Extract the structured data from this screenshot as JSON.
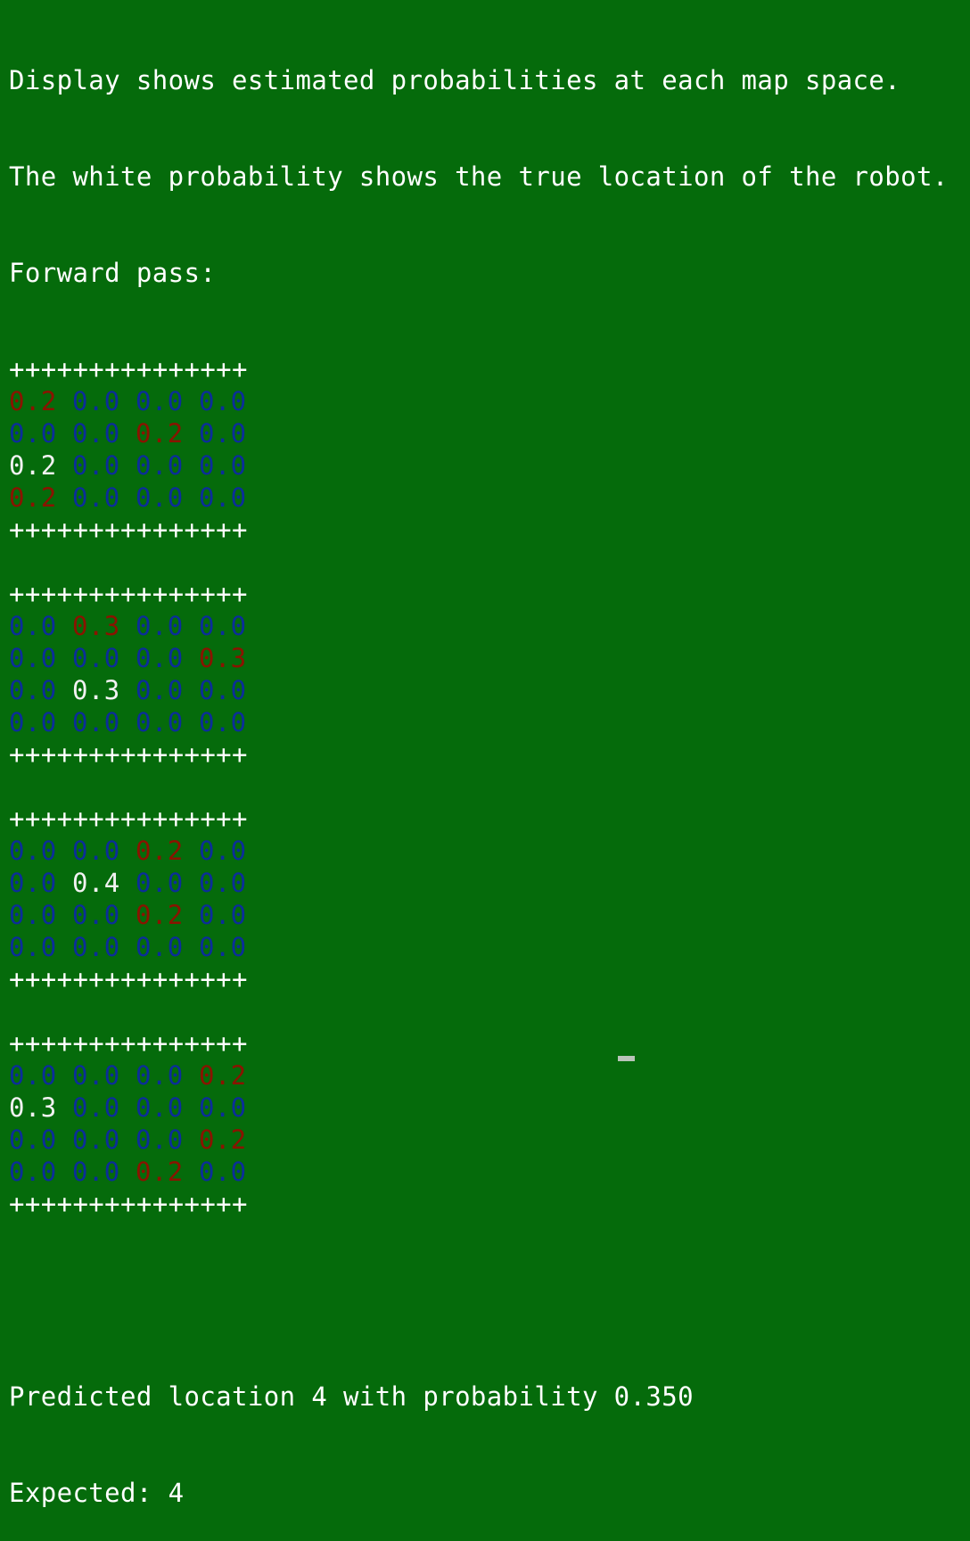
{
  "terminal": {
    "intro_lines": [
      "Display shows estimated probabilities at each map space.",
      "The white probability shows the true location of the robot.",
      "Forward pass:"
    ],
    "border": "+++++++++++++++",
    "grids": [
      {
        "rows": [
          [
            {
              "v": "0.2",
              "c": "red"
            },
            {
              "v": "0.0",
              "c": "blue"
            },
            {
              "v": "0.0",
              "c": "blue"
            },
            {
              "v": "0.0",
              "c": "blue"
            }
          ],
          [
            {
              "v": "0.0",
              "c": "blue"
            },
            {
              "v": "0.0",
              "c": "blue"
            },
            {
              "v": "0.2",
              "c": "red"
            },
            {
              "v": "0.0",
              "c": "blue"
            }
          ],
          [
            {
              "v": "0.2",
              "c": "white"
            },
            {
              "v": "0.0",
              "c": "blue"
            },
            {
              "v": "0.0",
              "c": "blue"
            },
            {
              "v": "0.0",
              "c": "blue"
            }
          ],
          [
            {
              "v": "0.2",
              "c": "red"
            },
            {
              "v": "0.0",
              "c": "blue"
            },
            {
              "v": "0.0",
              "c": "blue"
            },
            {
              "v": "0.0",
              "c": "blue"
            }
          ]
        ]
      },
      {
        "rows": [
          [
            {
              "v": "0.0",
              "c": "blue"
            },
            {
              "v": "0.3",
              "c": "red"
            },
            {
              "v": "0.0",
              "c": "blue"
            },
            {
              "v": "0.0",
              "c": "blue"
            }
          ],
          [
            {
              "v": "0.0",
              "c": "blue"
            },
            {
              "v": "0.0",
              "c": "blue"
            },
            {
              "v": "0.0",
              "c": "blue"
            },
            {
              "v": "0.3",
              "c": "red"
            }
          ],
          [
            {
              "v": "0.0",
              "c": "blue"
            },
            {
              "v": "0.3",
              "c": "white"
            },
            {
              "v": "0.0",
              "c": "blue"
            },
            {
              "v": "0.0",
              "c": "blue"
            }
          ],
          [
            {
              "v": "0.0",
              "c": "blue"
            },
            {
              "v": "0.0",
              "c": "blue"
            },
            {
              "v": "0.0",
              "c": "blue"
            },
            {
              "v": "0.0",
              "c": "blue"
            }
          ]
        ]
      },
      {
        "rows": [
          [
            {
              "v": "0.0",
              "c": "blue"
            },
            {
              "v": "0.0",
              "c": "blue"
            },
            {
              "v": "0.2",
              "c": "red"
            },
            {
              "v": "0.0",
              "c": "blue"
            }
          ],
          [
            {
              "v": "0.0",
              "c": "blue"
            },
            {
              "v": "0.4",
              "c": "white"
            },
            {
              "v": "0.0",
              "c": "blue"
            },
            {
              "v": "0.0",
              "c": "blue"
            }
          ],
          [
            {
              "v": "0.0",
              "c": "blue"
            },
            {
              "v": "0.0",
              "c": "blue"
            },
            {
              "v": "0.2",
              "c": "red"
            },
            {
              "v": "0.0",
              "c": "blue"
            }
          ],
          [
            {
              "v": "0.0",
              "c": "blue"
            },
            {
              "v": "0.0",
              "c": "blue"
            },
            {
              "v": "0.0",
              "c": "blue"
            },
            {
              "v": "0.0",
              "c": "blue"
            }
          ]
        ]
      },
      {
        "rows": [
          [
            {
              "v": "0.0",
              "c": "blue"
            },
            {
              "v": "0.0",
              "c": "blue"
            },
            {
              "v": "0.0",
              "c": "blue"
            },
            {
              "v": "0.2",
              "c": "red"
            }
          ],
          [
            {
              "v": "0.3",
              "c": "white"
            },
            {
              "v": "0.0",
              "c": "blue"
            },
            {
              "v": "0.0",
              "c": "blue"
            },
            {
              "v": "0.0",
              "c": "blue"
            }
          ],
          [
            {
              "v": "0.0",
              "c": "blue"
            },
            {
              "v": "0.0",
              "c": "blue"
            },
            {
              "v": "0.0",
              "c": "blue"
            },
            {
              "v": "0.2",
              "c": "red"
            }
          ],
          [
            {
              "v": "0.0",
              "c": "blue"
            },
            {
              "v": "0.0",
              "c": "blue"
            },
            {
              "v": "0.2",
              "c": "red"
            },
            {
              "v": "0.0",
              "c": "blue"
            }
          ]
        ]
      }
    ],
    "result_lines": [
      "Predicted location 4 with probability 0.350",
      "Expected: 4"
    ]
  },
  "colors": {
    "background": "#056b0b",
    "text": "#ffffff",
    "blue": "#0b2d9a",
    "red": "#8a1300",
    "white": "#f2f2f2"
  }
}
